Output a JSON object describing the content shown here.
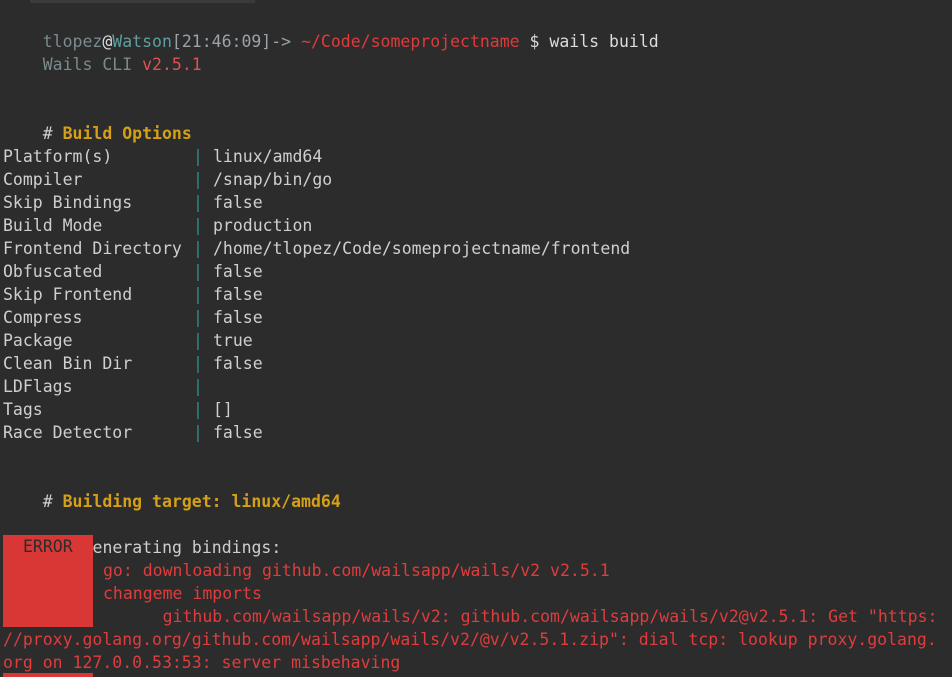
{
  "prompt": {
    "user": "tlopez",
    "at": "@",
    "host": "Watson",
    "time": "[21:46:09]",
    "arrow": "->",
    "cwd": "~/Code/someprojectname",
    "dollar": "$",
    "command": "wails build"
  },
  "cli": {
    "name": "Wails CLI",
    "version": "v2.5.1"
  },
  "build_options": {
    "hash": "#",
    "heading": "Build Options",
    "separator": "|",
    "rows": [
      {
        "key": "Platform(s)",
        "value": "linux/amd64"
      },
      {
        "key": "Compiler",
        "value": "/snap/bin/go"
      },
      {
        "key": "Skip Bindings",
        "value": "false"
      },
      {
        "key": "Build Mode",
        "value": "production"
      },
      {
        "key": "Frontend Directory",
        "value": "/home/tlopez/Code/someprojectname/frontend"
      },
      {
        "key": "Obfuscated",
        "value": "false"
      },
      {
        "key": "Skip Frontend",
        "value": "false"
      },
      {
        "key": "Compress",
        "value": "false"
      },
      {
        "key": "Package",
        "value": "true"
      },
      {
        "key": "Clean Bin Dir",
        "value": "false"
      },
      {
        "key": "LDFlags",
        "value": ""
      },
      {
        "key": "Tags",
        "value": "[]"
      },
      {
        "key": "Race Detector",
        "value": "false"
      }
    ]
  },
  "building": {
    "hash": "#",
    "heading": "Building target: linux/amd64"
  },
  "step": {
    "bullet": "•",
    "label": "Generating bindings:"
  },
  "error": {
    "label": "ERROR",
    "lines": [
      "go: downloading github.com/wailsapp/wails/v2 v2.5.1",
      "changeme imports",
      "      github.com/wailsapp/wails/v2: github.com/wailsapp/wails/v2@v2.5.1: Get \"https:",
      "//proxy.golang.org/github.com/wailsapp/wails/v2/@v/v2.5.1.zip\": dial tcp: lookup proxy.golang.",
      "org on 127.0.0.53:53: server misbehaving"
    ]
  },
  "colors": {
    "background": "#2c2c2c",
    "error_red": "#d93636",
    "heading_yellow": "#d4a017",
    "separator_teal": "#2e8b8b"
  }
}
